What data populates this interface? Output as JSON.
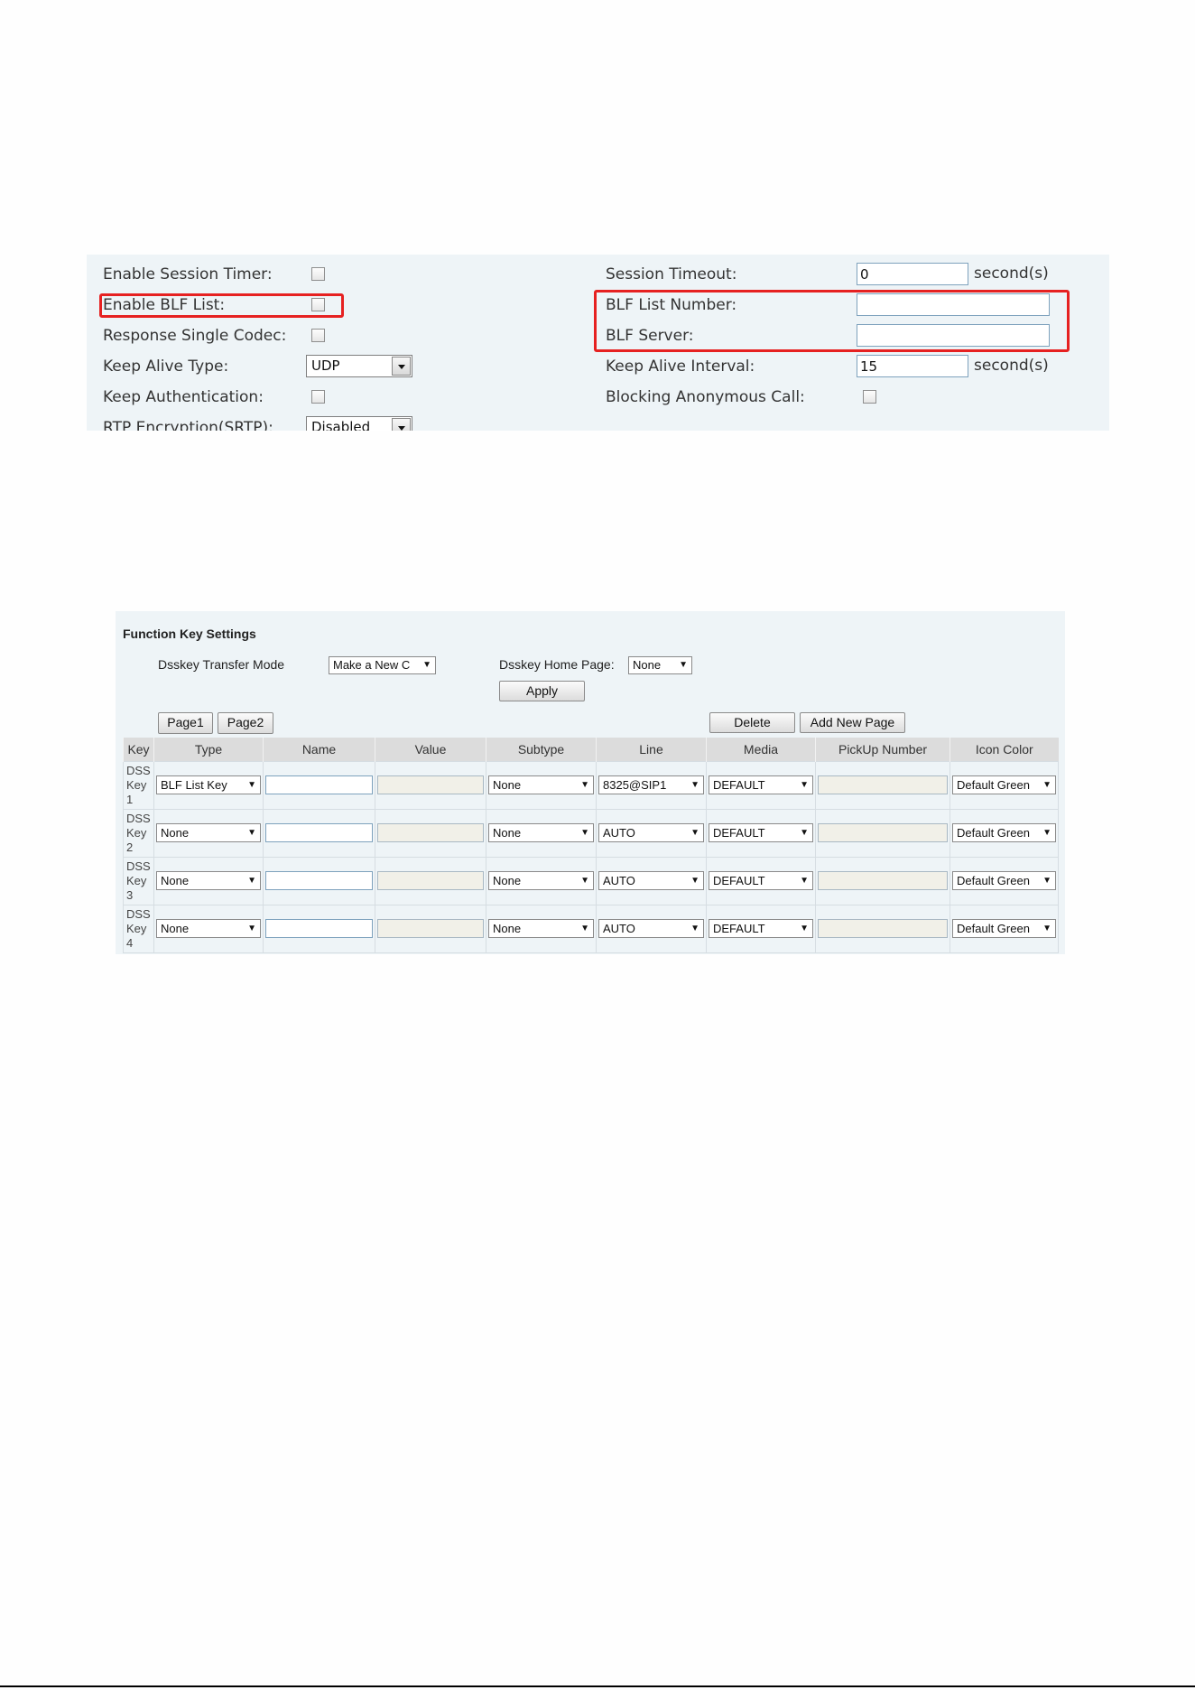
{
  "sip_panel": {
    "left_fields": [
      {
        "label": "Enable Session Timer:",
        "type": "checkbox"
      },
      {
        "label": "Enable BLF List:",
        "type": "checkbox"
      },
      {
        "label": "Response Single Codec:",
        "type": "checkbox"
      },
      {
        "label": "Keep Alive Type:",
        "type": "select",
        "value": "UDP"
      },
      {
        "label": "Keep Authentication:",
        "type": "checkbox"
      },
      {
        "label": "RTP Encryption(SRTP):",
        "type": "select",
        "value": "Disabled"
      }
    ],
    "right_fields": [
      {
        "label": "Session Timeout:",
        "type": "input",
        "value": "0",
        "unit": "second(s)"
      },
      {
        "label": "BLF List Number:",
        "type": "input",
        "value": ""
      },
      {
        "label": "BLF Server:",
        "type": "input",
        "value": ""
      },
      {
        "label": "Keep Alive Interval:",
        "type": "input",
        "value": "15",
        "unit": "second(s)"
      },
      {
        "label": "Blocking Anonymous Call:",
        "type": "checkbox"
      }
    ],
    "highlight_color": "#e62121"
  },
  "function_keys": {
    "title": "Function Key Settings",
    "transfer_mode": {
      "label": "Dsskey Transfer Mode",
      "value": "Make a New C"
    },
    "home_page": {
      "label": "Dsskey Home Page:",
      "value": "None"
    },
    "apply_label": "Apply",
    "page_tabs": [
      "Page1",
      "Page2"
    ],
    "delete_label": "Delete",
    "add_page_label": "Add New Page",
    "columns": [
      "Key",
      "Type",
      "Name",
      "Value",
      "Subtype",
      "Line",
      "Media",
      "PickUp Number",
      "Icon Color"
    ],
    "rows": [
      {
        "key": [
          "DSS",
          "Key",
          "1"
        ],
        "type": "BLF List Key",
        "name": "",
        "value": "",
        "subtype": "None",
        "line": "8325@SIP1",
        "media": "DEFAULT",
        "pickup": "",
        "icon_color": "Default Green"
      },
      {
        "key": [
          "DSS",
          "Key",
          "2"
        ],
        "type": "None",
        "name": "",
        "value": "",
        "subtype": "None",
        "line": "AUTO",
        "media": "DEFAULT",
        "pickup": "",
        "icon_color": "Default Green"
      },
      {
        "key": [
          "DSS",
          "Key",
          "3"
        ],
        "type": "None",
        "name": "",
        "value": "",
        "subtype": "None",
        "line": "AUTO",
        "media": "DEFAULT",
        "pickup": "",
        "icon_color": "Default Green"
      },
      {
        "key": [
          "DSS",
          "Key",
          "4"
        ],
        "type": "None",
        "name": "",
        "value": "",
        "subtype": "None",
        "line": "AUTO",
        "media": "DEFAULT",
        "pickup": "",
        "icon_color": "Default Green"
      }
    ]
  }
}
